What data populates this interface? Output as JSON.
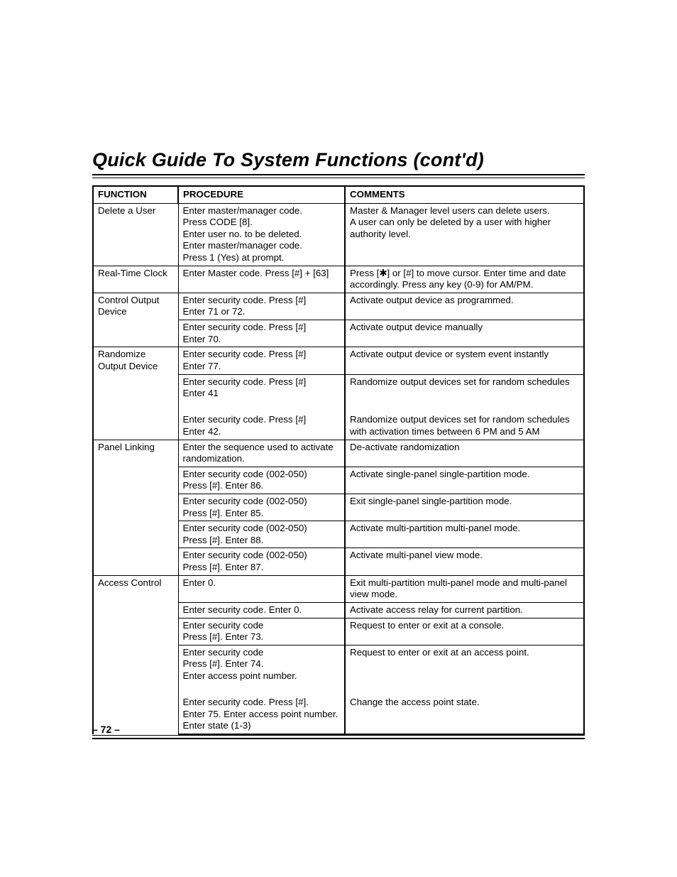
{
  "title": "Quick Guide To System Functions (cont'd)",
  "headers": {
    "function": "FUNCTION",
    "procedure": "PROCEDURE",
    "comments": "COMMENTS"
  },
  "rows": {
    "delete_user": {
      "function": "Delete a User",
      "p1": "Enter master/manager code.",
      "p2": "Press CODE [8].",
      "p3": "Enter user no. to be deleted.",
      "p4": "Enter master/manager code.",
      "p5": "Press 1 (Yes) at prompt.",
      "c1": "Master & Manager level users can delete users.",
      "c2": "A user can only be deleted by a user with higher authority level."
    },
    "rtc": {
      "function": "Real-Time Clock",
      "p1": "Enter Master code.  Press [#] + [63]",
      "c1": "Press [✱] or [#] to move cursor. Enter time and date accordingly. Press any key (0-9) for AM/PM."
    },
    "control_output": {
      "function": "Control Output Device",
      "r1": {
        "p1": "Enter security code.  Press [#]",
        "p2": "Enter 71 or 72.",
        "c1": "Activate output device as programmed."
      },
      "r2": {
        "p1": "Enter security code.  Press [#]",
        "p2": "Enter 70.",
        "c1": "Activate output device manually"
      }
    },
    "randomize": {
      "function": "Randomize Output Device",
      "r1": {
        "p1": "Enter security code.  Press [#]",
        "p2": "Enter 77.",
        "c1": "Activate output device or system event instantly"
      },
      "r2": {
        "p1": "Enter security code.  Press [#]",
        "p2": "Enter 41",
        "c1": "Randomize output devices set for random schedules"
      },
      "r3": {
        "p1": "Enter security code.  Press [#]",
        "p2": "Enter 42.",
        "c1": "Randomize output devices set for random schedules with activation times between 6 PM and 5 AM"
      }
    },
    "panel_linking": {
      "function": "Panel Linking",
      "r1": {
        "p1": "Enter the sequence used to activate randomization.",
        "c1": "De-activate randomization"
      },
      "r2": {
        "p1": "Enter security code (002-050)",
        "p2": "Press [#].  Enter 86.",
        "c1": "Activate single-panel single-partition mode."
      },
      "r3": {
        "p1": "Enter security code (002-050)",
        "p2": "Press [#].  Enter 85.",
        "c1": "Exit single-panel single-partition mode."
      },
      "r4": {
        "p1": "Enter security code (002-050)",
        "p2": "Press [#].  Enter 88.",
        "c1": "Activate multi-partition multi-panel mode."
      },
      "r5": {
        "p1": "Enter security code (002-050)",
        "p2": "Press [#].  Enter 87.",
        "c1": "Activate multi-panel view mode."
      }
    },
    "access_control": {
      "function": "Access Control",
      "r1": {
        "p1": "Enter 0.",
        "c1": "Exit multi-partition multi-panel mode and multi-panel view mode."
      },
      "r2": {
        "p1": "Enter security code.  Enter 0.",
        "c1": "Activate access relay for current partition."
      },
      "r3": {
        "p1": "Enter security code",
        "p2": "Press [#].  Enter 73.",
        "c1": "Request to enter or exit at a console."
      },
      "r4": {
        "p1": "Enter security code",
        "p2": "Press [#].  Enter 74.",
        "p3": "Enter access point number.",
        "c1": "Request to enter or exit at an access point."
      },
      "r5": {
        "p1": "Enter security code.  Press [#].",
        "p2": "Enter 75. Enter access point number.",
        "p3": "Enter state (1-3)",
        "c1": "Change the access point state."
      }
    }
  },
  "page_number": "– 72 –"
}
